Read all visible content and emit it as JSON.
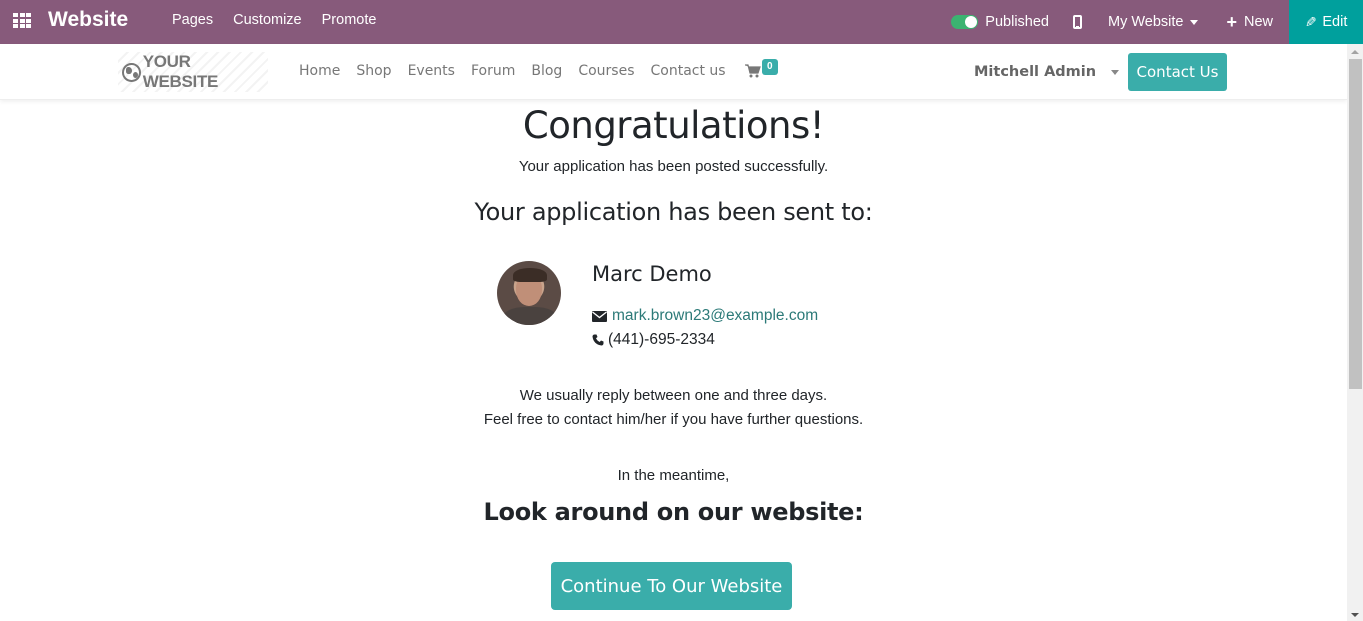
{
  "topbar": {
    "app_title": "Website",
    "menu": [
      "Pages",
      "Customize",
      "Promote"
    ],
    "published_label": "Published",
    "published_on": true,
    "my_website_label": "My Website",
    "new_label": "New",
    "edit_label": "Edit",
    "colors": {
      "bar": "#875a7b",
      "edit": "#00a09d",
      "toggle": "#3cb371"
    }
  },
  "navbar": {
    "logo_text": "YOUR WEBSITE",
    "links": [
      "Home",
      "Shop",
      "Events",
      "Forum",
      "Blog",
      "Courses",
      "Contact us"
    ],
    "cart_count": "0",
    "user_name": "Mitchell Admin",
    "contact_button": "Contact Us",
    "accent": "#3aadaa"
  },
  "main": {
    "title": "Congratulations!",
    "subtitle": "Your application has been posted successfully.",
    "sent_to_heading": "Your application has been sent to:",
    "contact": {
      "name": "Marc Demo",
      "email": "mark.brown23@example.com",
      "phone": "(441)-695-2334"
    },
    "reply_line_1": "We usually reply between one and three days.",
    "reply_line_2": "Feel free to contact him/her if you have further questions.",
    "meantime": "In the meantime,",
    "look_around_heading": "Look around on our website:",
    "continue_button": "Continue To Our Website"
  }
}
